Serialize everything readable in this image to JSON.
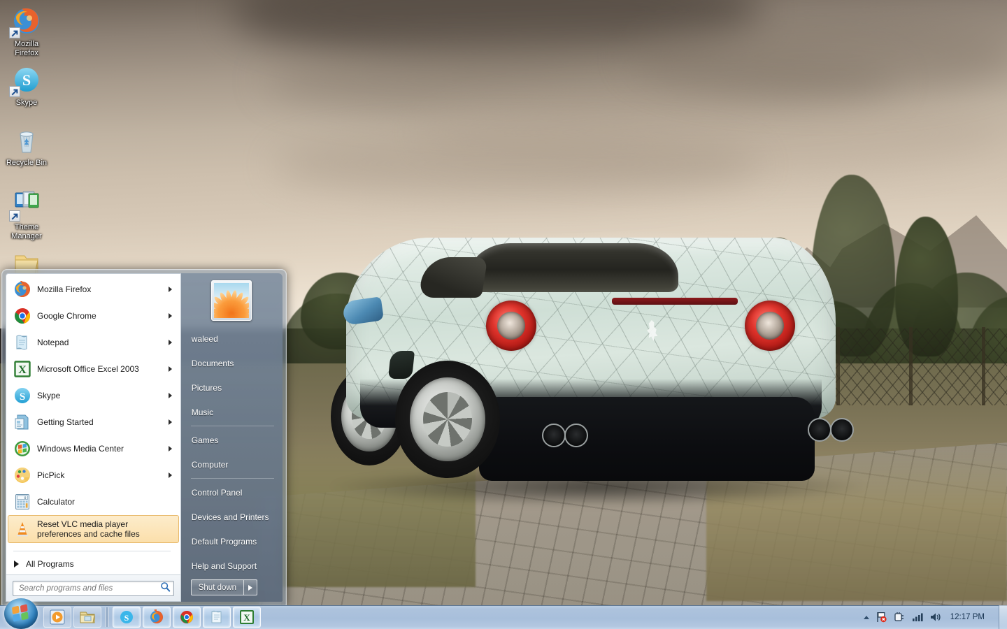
{
  "desktop": {
    "icons": [
      {
        "name": "Mozilla Firefox",
        "label_line1": "Mozilla",
        "label_line2": "Firefox",
        "icon": "firefox-icon",
        "shortcut": true
      },
      {
        "name": "Skype",
        "label_line1": "Skype",
        "label_line2": "",
        "icon": "skype-icon",
        "shortcut": true
      },
      {
        "name": "Recycle Bin",
        "label_line1": "Recycle Bin",
        "label_line2": "",
        "icon": "recycle-bin-icon",
        "shortcut": false
      },
      {
        "name": "Theme Manager",
        "label_line1": "Theme",
        "label_line2": "Manager",
        "icon": "theme-manager-icon",
        "shortcut": true
      },
      {
        "name": "Folder",
        "label_line1": "",
        "label_line2": "",
        "icon": "folder-icon",
        "shortcut": false
      }
    ],
    "wallpaper_description": "White crackle-pattern Ferrari 599 GTB parked on a cobblestone road with trees, chain-link fence and hazy mountains under an overcast sepia sky"
  },
  "start_menu": {
    "programs": [
      {
        "label": "Mozilla Firefox",
        "icon": "firefox-icon",
        "has_submenu": true,
        "selected": false
      },
      {
        "label": "Google Chrome",
        "icon": "chrome-icon",
        "has_submenu": true,
        "selected": false
      },
      {
        "label": "Notepad",
        "icon": "notepad-icon",
        "has_submenu": true,
        "selected": false
      },
      {
        "label": "Microsoft Office Excel 2003",
        "icon": "excel-icon",
        "has_submenu": true,
        "selected": false
      },
      {
        "label": "Skype",
        "icon": "skype-icon",
        "has_submenu": true,
        "selected": false
      },
      {
        "label": "Getting Started",
        "icon": "getting-started-icon",
        "has_submenu": true,
        "selected": false
      },
      {
        "label": "Windows Media Center",
        "icon": "windows-media-center-icon",
        "has_submenu": true,
        "selected": false
      },
      {
        "label": "PicPick",
        "icon": "picpick-icon",
        "has_submenu": true,
        "selected": false
      },
      {
        "label": "Calculator",
        "icon": "calculator-icon",
        "has_submenu": false,
        "selected": false
      },
      {
        "label": "Reset VLC media player preferences and cache files",
        "icon": "vlc-icon",
        "has_submenu": false,
        "selected": true
      }
    ],
    "all_programs_label": "All Programs",
    "search": {
      "placeholder": "Search programs and files",
      "value": "",
      "icon": "search-icon"
    },
    "user": {
      "name": "waleed",
      "avatar_icon": "flower-avatar"
    },
    "right_links": [
      {
        "label": "Documents",
        "group": 1
      },
      {
        "label": "Pictures",
        "group": 1
      },
      {
        "label": "Music",
        "group": 1
      },
      {
        "label": "Games",
        "group": 2
      },
      {
        "label": "Computer",
        "group": 2
      },
      {
        "label": "Control Panel",
        "group": 3
      },
      {
        "label": "Devices and Printers",
        "group": 3
      },
      {
        "label": "Default Programs",
        "group": 3
      },
      {
        "label": "Help and Support",
        "group": 3
      }
    ],
    "shutdown": {
      "label": "Shut down",
      "more_icon": "chevron-right-icon"
    },
    "accent_selected_bg": "#fbdfab",
    "accent_selected_border": "#e8b96a"
  },
  "taskbar": {
    "start_button": {
      "name": "Start",
      "icon": "windows-orb-icon"
    },
    "quick_launch": [
      {
        "name": "Windows Media Player",
        "icon": "media-player-icon"
      },
      {
        "name": "Windows Explorer",
        "icon": "explorer-icon"
      }
    ],
    "running": [
      {
        "name": "Skype",
        "icon": "skype-icon"
      },
      {
        "name": "Mozilla Firefox",
        "icon": "firefox-icon"
      },
      {
        "name": "Google Chrome",
        "icon": "chrome-icon"
      },
      {
        "name": "Notepad",
        "icon": "notepad-icon"
      },
      {
        "name": "Microsoft Office Excel 2003",
        "icon": "excel-icon"
      }
    ],
    "tray": {
      "show_hidden_icon": "chevron-up-icon",
      "icons": [
        {
          "name": "Action Center",
          "icon": "flag-with-error-icon"
        },
        {
          "name": "Safely Remove Hardware",
          "icon": "eject-device-icon"
        },
        {
          "name": "Network",
          "icon": "network-signal-icon"
        },
        {
          "name": "Volume",
          "icon": "speaker-icon"
        }
      ],
      "clock": "12:17 PM"
    },
    "background_color": "#a8bfdb"
  }
}
